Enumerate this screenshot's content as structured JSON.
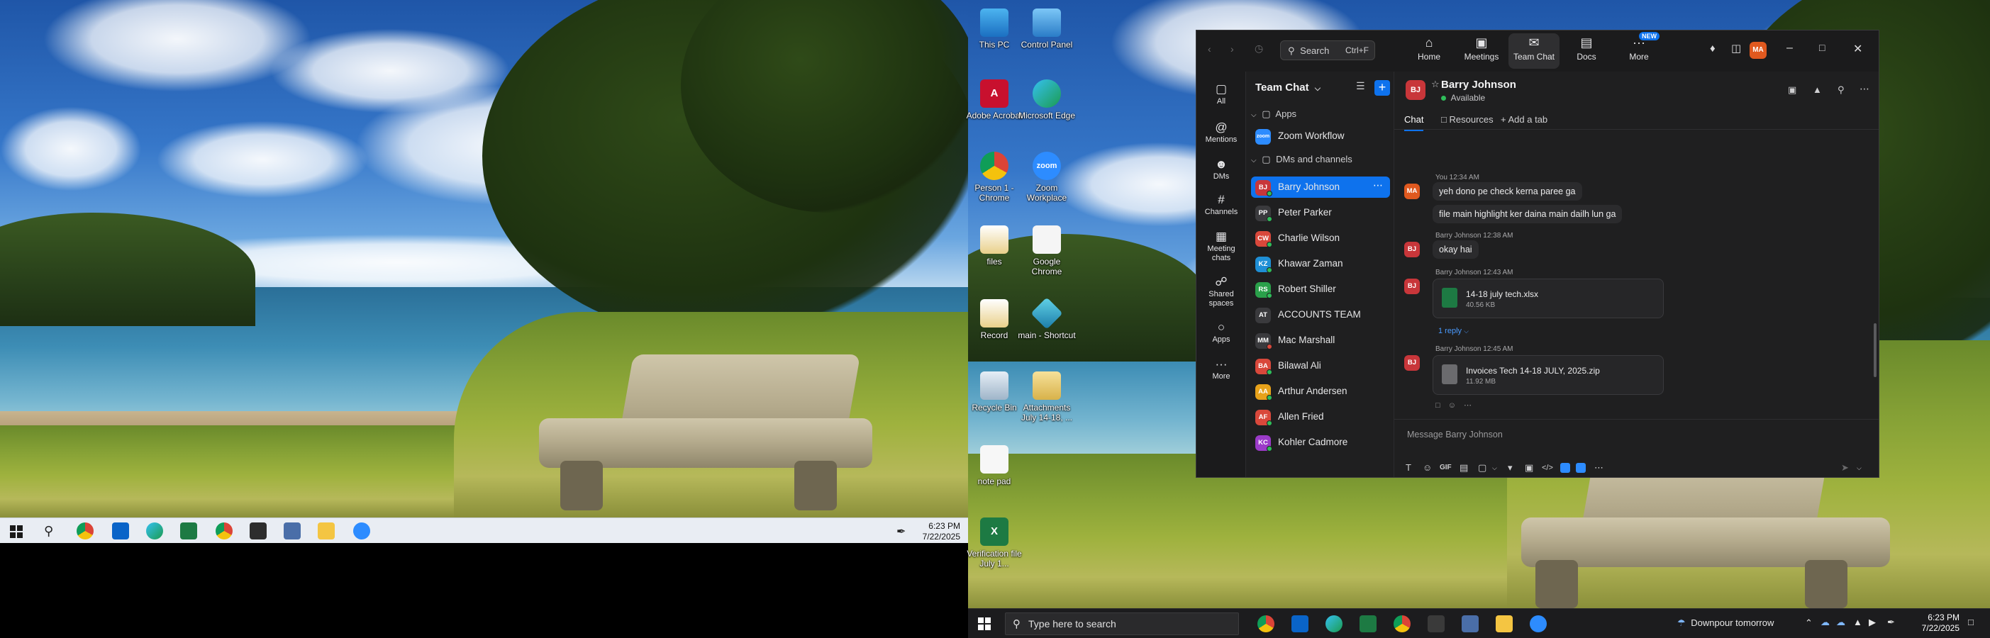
{
  "left_taskbar": {
    "time": "6:23 PM",
    "date": "7/22/2025"
  },
  "right_taskbar": {
    "search_placeholder": "Type here to search",
    "weather": "Downpour tomorrow",
    "time": "6:23 PM",
    "date": "7/22/2025"
  },
  "desktop_icons": [
    {
      "label": "This PC"
    },
    {
      "label": "Control Panel"
    },
    {
      "label": "Adobe Acrobat"
    },
    {
      "label": "Microsoft Edge"
    },
    {
      "label": "Person 1 - Chrome"
    },
    {
      "label": "Zoom Workplace"
    },
    {
      "label": "files"
    },
    {
      "label": "Google Chrome"
    },
    {
      "label": "Record"
    },
    {
      "label": "main - Shortcut"
    },
    {
      "label": "Recycle Bin"
    },
    {
      "label": "Attachments July 14-18, ..."
    },
    {
      "label": "note pad"
    },
    {
      "label": "Verification file July 1..."
    }
  ],
  "zoom": {
    "search": {
      "label": "Search",
      "shortcut": "Ctrl+F"
    },
    "nav": {
      "home": "Home",
      "meetings": "Meetings",
      "team_chat": "Team Chat",
      "docs": "Docs",
      "more": "More",
      "new_badge": "NEW"
    },
    "user_initials": "MA",
    "rail": {
      "all": "All",
      "mentions": "Mentions",
      "dms": "DMs",
      "channels": "Channels",
      "meeting_chats": "Meeting chats",
      "shared_spaces": "Shared spaces",
      "apps": "Apps",
      "more": "More"
    },
    "list_title": "Team Chat",
    "sections": {
      "apps": "Apps",
      "dms": "DMs and channels"
    },
    "apps": [
      {
        "name": "Zoom Workflow",
        "avatar": "zoom"
      }
    ],
    "contacts": [
      {
        "name": "Barry Johnson",
        "initials": "BJ",
        "color": "#c8363a",
        "presence": "#2fbd5a",
        "selected": true
      },
      {
        "name": "Peter Parker",
        "initials": "PP",
        "color": "#3a3a3d",
        "presence": "#2fbd5a"
      },
      {
        "name": "Charlie Wilson",
        "initials": "CW",
        "color": "#d9483b",
        "presence": "#2fbd5a"
      },
      {
        "name": "Khawar Zaman",
        "initials": "KZ",
        "color": "#1f8fd6",
        "presence": "#2fbd5a"
      },
      {
        "name": "Robert Shiller",
        "initials": "RS",
        "color": "#2aa04a",
        "presence": "#2fbd5a"
      },
      {
        "name": "ACCOUNTS TEAM",
        "initials": "AT",
        "color": "#3a3a3d",
        "presence": ""
      },
      {
        "name": "Mac Marshall",
        "initials": "MM",
        "color": "#3a3a3d",
        "presence": "#d9483b"
      },
      {
        "name": "Bilawal Ali",
        "initials": "BA",
        "color": "#d9483b",
        "presence": "#2fbd5a"
      },
      {
        "name": "Arthur Andersen",
        "initials": "AA",
        "color": "#e8a21a",
        "presence": "#2fbd5a"
      },
      {
        "name": "Allen Fried",
        "initials": "AF",
        "color": "#d9483b",
        "presence": "#2fbd5a"
      },
      {
        "name": "Kohler Cadmore",
        "initials": "KC",
        "color": "#9b3bc8",
        "presence": "#2fbd5a"
      }
    ],
    "chat": {
      "name": "Barry Johnson",
      "initials": "BJ",
      "status": "Available",
      "tabs": {
        "chat": "Chat",
        "resources": "Resources",
        "add_tab": "Add a tab"
      },
      "messages": {
        "m1_meta": "You 12:34 AM",
        "m1_text": "yeh dono pe check kerna paree ga",
        "m2_text": "file main highlight ker daina main dailh lun ga",
        "m3_meta": "Barry Johnson 12:38 AM",
        "m3_text": "okay hai",
        "m4_meta": "Barry Johnson 12:43 AM",
        "m4_file": "14-18 july tech.xlsx",
        "m4_size": "40.56 KB",
        "m4_reply": "1 reply",
        "m5_meta": "Barry Johnson 12:45 AM",
        "m5_file": "Invoices Tech 14-18 JULY, 2025.zip",
        "m5_size": "11.92 MB"
      },
      "compose_placeholder": "Message Barry Johnson",
      "gif_label": "GIF"
    }
  }
}
